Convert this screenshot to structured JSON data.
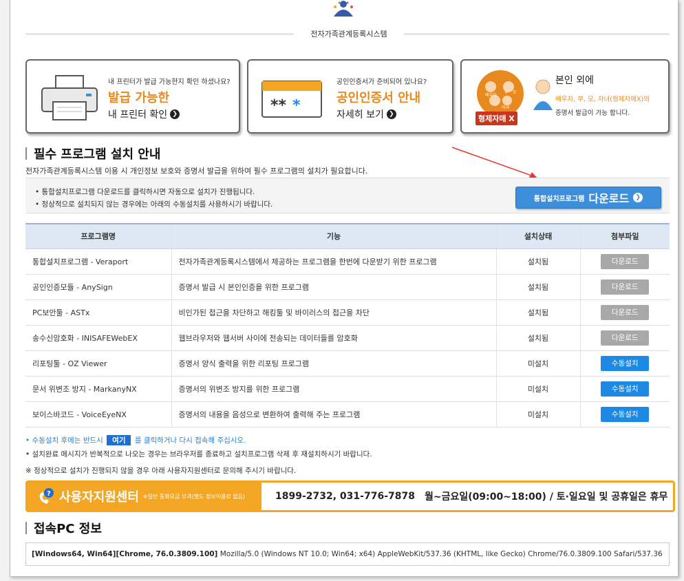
{
  "header": {
    "system_title": "전자가족관계등록시스템"
  },
  "banners": [
    {
      "sub": "내 프린터가 발급 가능한지 확인 하셨나요?",
      "main": "발급 가능한",
      "link": "내 프린터 확인"
    },
    {
      "sub": "공인인증서가 준비되어 있나요?",
      "main": "공인인증서 안내",
      "link": "자세히 보기"
    },
    {
      "main": "본인 외에",
      "line2": "배우자, 부, 모, 자녀(형제자매X)의",
      "line3": "증명서 발급이 가능 합니다.",
      "badge": "형제자매 X",
      "icon_labels": [
        "배우자",
        "부",
        "모",
        "자녀"
      ]
    }
  ],
  "install": {
    "title": "필수 프로그램 설치 안내",
    "desc": "전자가족관계등록시스템 이용 시 개인정보 보호와 증명서 발급을 위하여 필수 프로그램의 설치가 필요합니다.",
    "notes": [
      "• 통합설치프로그램 다운로드를 클릭하시면 자동으로 설치가 진행됩니다.",
      "• 정상적으로 설치되지 않는 경우에는 아래의 수동설치를 사용하시기 바랍니다."
    ],
    "download_small": "통합설치프로그램",
    "download_big": "다운로드"
  },
  "table": {
    "headers": [
      "프로그램명",
      "기능",
      "설치상태",
      "첨부파일"
    ],
    "rows": [
      {
        "name": "통합설치프로그램 - Veraport",
        "func": "전자가족관계등록시스템에서 제공하는 프로그램을 한번에 다운받기 위한 프로그램",
        "status": "설치됨",
        "file": "다운로드"
      },
      {
        "name": "공인인증모듈 - AnySign",
        "func": "증명서 발급 시 본인인증을 위한 프로그램",
        "status": "설치됨",
        "file": "다운로드"
      },
      {
        "name": "PC보안툴 - ASTx",
        "func": "비인가된 접근을 차단하고 해킹툴 및 바이러스의 접근을 차단",
        "status": "설치됨",
        "file": "다운로드"
      },
      {
        "name": "송수신암호화 - INISAFEWebEX",
        "func": "웹브라우저와 웹서버 사이에 전송되는 데이터들를 암호화",
        "status": "설치됨",
        "file": "다운로드"
      },
      {
        "name": "리포팅툴 - OZ Viewer",
        "func": "증명서 양식 출력을 위한 리포팅 프로그램",
        "status": "미설치",
        "file": "수동설치"
      },
      {
        "name": "문서 위변조 방지 - MarkanyNX",
        "func": "증명서의 위변조 방지를 위한 프로그램",
        "status": "미설치",
        "file": "수동설치"
      },
      {
        "name": "보이스바코드 - VoiceEyeNX",
        "func": "증명서의 내용을 음성으로 변환하여 출력해 주는 프로그램",
        "status": "미설치",
        "file": "수동설치"
      }
    ]
  },
  "after_notes": {
    "n1_pre": "• 수동설치 후에는 반드시",
    "n1_btn": "여기",
    "n1_post": "를 클릭하거나 다시 접속해 주십시오.",
    "n2": "• 설치완료 메시지가 반복적으로 나오는 경우는 브라우저를 종료하고 설치프로그램 삭제 후 재설치하시기 바랍니다.",
    "n3": "※ 정상적으로 설치가 진행되지 않을 경우 아래 사용자지원센터로 문의해 주시기 바랍니다."
  },
  "support": {
    "title": "사용자지원센터",
    "sub": "※일반 통화요금 부과(별도 정보이용료 없음)",
    "phones": "1899-2732, 031-776-7878",
    "hours": "월~금요일(09:00~18:00) / 토·일요일 및 공휴일은 휴무"
  },
  "pc": {
    "title": "접속PC 정보",
    "env": "[Windows64, Win64][Chrome, 76.0.3809.100]",
    "ua": "Mozilla/5.0 (Windows NT 10.0; Win64; x64) AppleWebKit/537.36 (KHTML, like Gecko) Chrome/76.0.3809.100 Safari/537.36"
  },
  "colors": {
    "accent_orange": "#e8891f",
    "button_blue": "#1e88e5",
    "support_orange": "#f3a624"
  }
}
